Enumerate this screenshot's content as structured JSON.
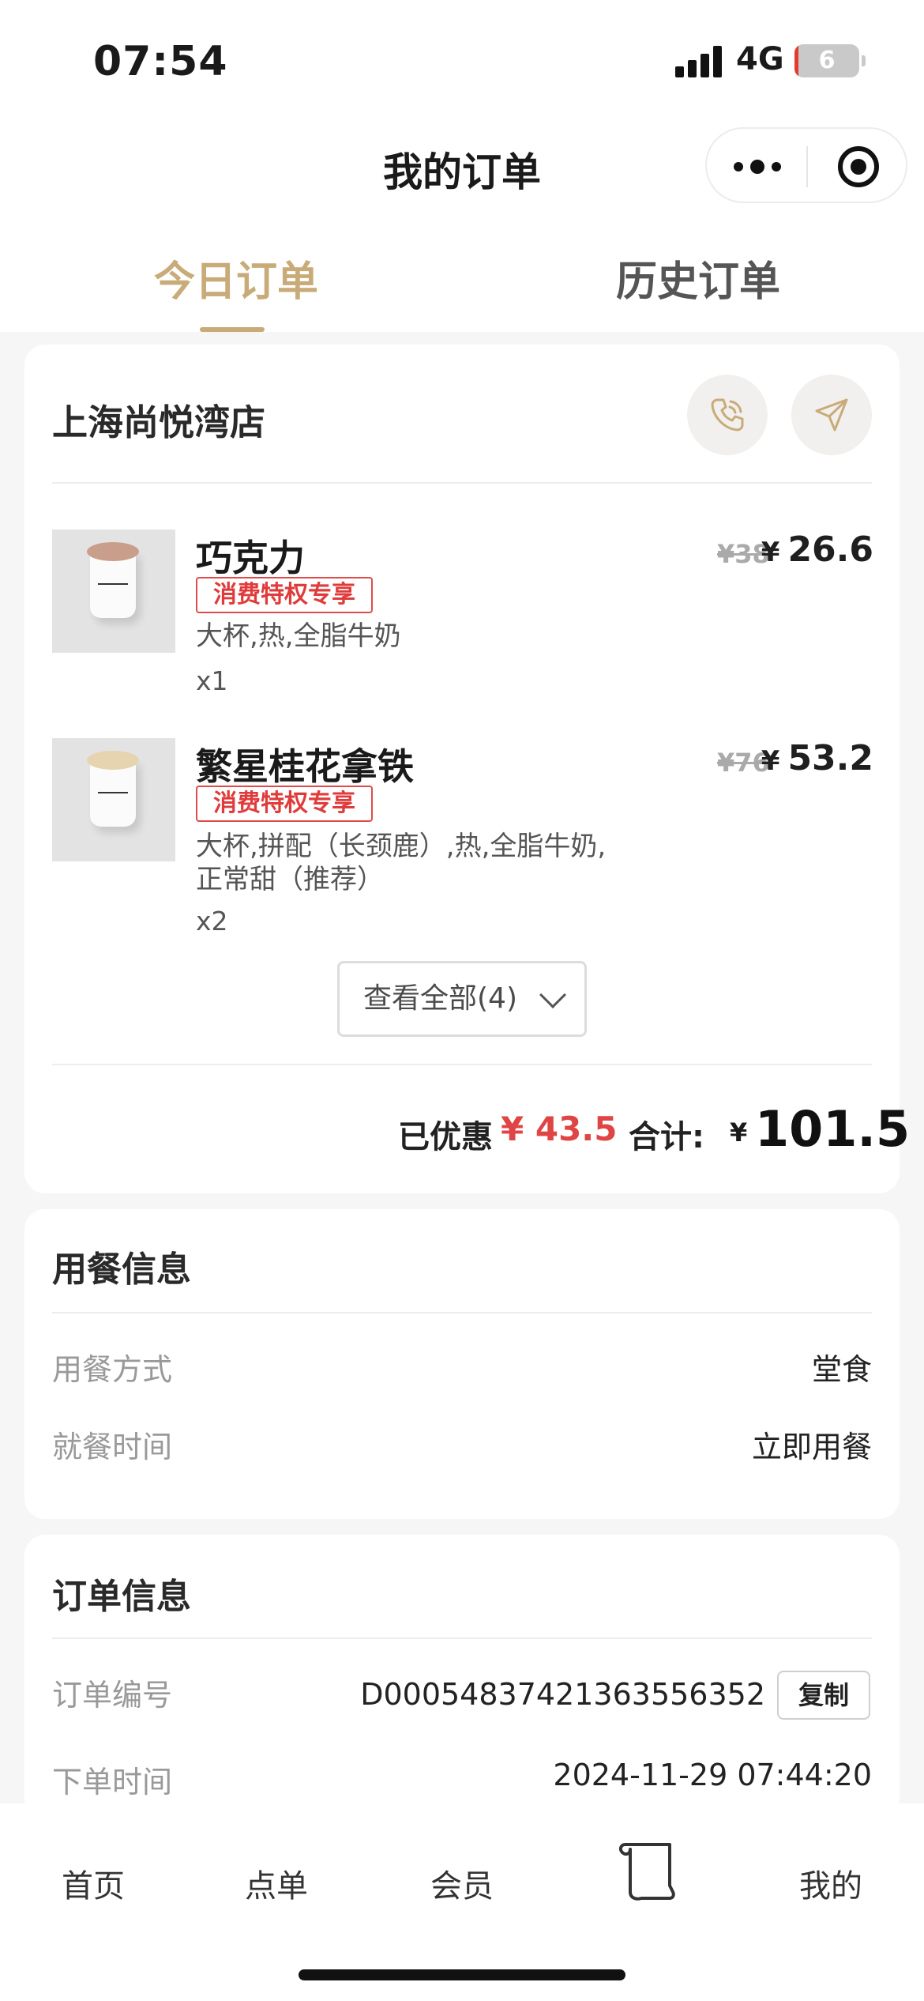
{
  "status": {
    "time": "07:54",
    "network": "4G",
    "battery": "6",
    "battery_level": 0.06
  },
  "nav": {
    "title": "我的订单"
  },
  "tabs": [
    {
      "label": "今日订单"
    },
    {
      "label": "历史订单"
    }
  ],
  "store": {
    "name": "上海尚悦湾店"
  },
  "items": [
    {
      "name": "巧克力",
      "badge": "消费特权专享",
      "spec": "大杯,热,全脂牛奶",
      "qty": "x1",
      "original_price": "¥38",
      "currency": "¥",
      "price": "26.6",
      "foam_color": "#c99f8c"
    },
    {
      "name": "繁星桂花拿铁",
      "badge": "消费特权专享",
      "spec": "大杯,拼配（长颈鹿）,热,全脂牛奶,正常甜（推荐）",
      "qty": "x2",
      "original_price": "¥76",
      "currency": "¥",
      "price": "53.2",
      "foam_color": "#e6d3b0"
    }
  ],
  "view_all": {
    "label": "查看全部(4)"
  },
  "totals": {
    "discount_label": "已优惠",
    "discount_value": "¥ 43.5",
    "total_label": "合计:",
    "currency": "¥",
    "total_value": "101.5"
  },
  "dining": {
    "title": "用餐信息",
    "rows": [
      {
        "label": "用餐方式",
        "value": "堂食"
      },
      {
        "label": "就餐时间",
        "value": "立即用餐"
      }
    ]
  },
  "order": {
    "title": "订单信息",
    "rows": [
      {
        "label": "订单编号",
        "value": "D0005483742136355635​2"
      },
      {
        "label": "下单时间",
        "value": "2024-11-29 07:44:20"
      }
    ],
    "copy_label": "复制"
  },
  "tabbar": [
    {
      "label": "首页"
    },
    {
      "label": "点单"
    },
    {
      "label": "会员"
    },
    {
      "icon": "scroll-icon"
    },
    {
      "label": "我的"
    }
  ],
  "colors": {
    "gold": "#c8ab78",
    "red": "#e03b3b"
  }
}
